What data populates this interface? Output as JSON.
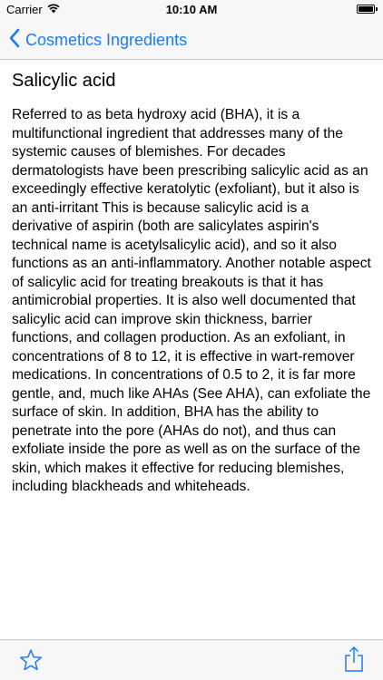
{
  "status_bar": {
    "carrier": "Carrier",
    "time": "10:10 AM",
    "wifi_icon": "wifi-icon",
    "battery_icon": "battery-icon"
  },
  "nav": {
    "back_label": "Cosmetics Ingredients",
    "back_icon": "chevron-left-icon",
    "accent_color": "#1d7bf6"
  },
  "article": {
    "title": "Salicylic acid",
    "body": "Referred to as beta hydroxy acid (BHA), it is a multifunctional ingredient that addresses many of the systemic causes of blemishes. For decades dermatologists have been prescribing salicylic acid as an exceedingly effective keratolytic (exfoliant), but it also is an anti-irritant This is because salicylic acid is a derivative of aspirin (both are salicylates aspirin's technical name is acetylsalicylic acid), and so it also functions as an anti-inflammatory. Another notable aspect of salicylic acid for treating breakouts is that it has antimicrobial properties. It is also well documented that salicylic acid can improve skin thickness, barrier functions, and collagen production. As an exfoliant, in concentrations of 8 to 12, it is effective in wart-remover medications. In concentrations of 0.5 to 2, it is far more gentle, and, much like AHAs (See AHA), can exfoliate the surface of skin. In addition, BHA has the ability to penetrate into the pore (AHAs do not), and thus can exfoliate inside the pore as well as on the surface of the skin, which makes it effective for reducing blemishes, including blackheads and whiteheads."
  },
  "toolbar": {
    "favorite_icon": "star-icon",
    "share_icon": "share-icon"
  }
}
